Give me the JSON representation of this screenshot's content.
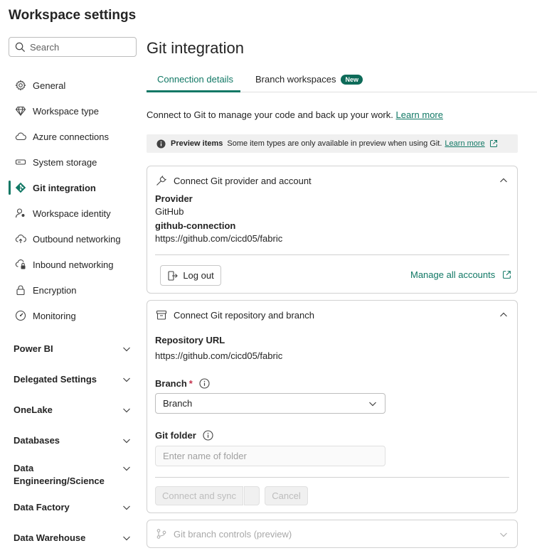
{
  "page": {
    "title": "Workspace settings"
  },
  "search": {
    "placeholder": "Search"
  },
  "sidebar": {
    "items": [
      {
        "label": "General"
      },
      {
        "label": "Workspace type"
      },
      {
        "label": "Azure connections"
      },
      {
        "label": "System storage"
      },
      {
        "label": "Git integration"
      },
      {
        "label": "Workspace identity"
      },
      {
        "label": "Outbound networking"
      },
      {
        "label": "Inbound networking"
      },
      {
        "label": "Encryption"
      },
      {
        "label": "Monitoring"
      }
    ],
    "groups": [
      {
        "label": "Power BI"
      },
      {
        "label": "Delegated Settings"
      },
      {
        "label": "OneLake"
      },
      {
        "label": "Databases"
      },
      {
        "label": "Data Engineering/Science"
      },
      {
        "label": "Data Factory"
      },
      {
        "label": "Data Warehouse"
      }
    ]
  },
  "main": {
    "title": "Git integration",
    "tabs": [
      {
        "label": "Connection details"
      },
      {
        "label": "Branch workspaces",
        "badge": "New"
      }
    ],
    "intro": "Connect to Git to manage your code and back up your work.",
    "intro_link": "Learn more",
    "preview": {
      "title": "Preview items",
      "text": "Some item types are only available in preview when using Git.",
      "link": "Learn more"
    },
    "provider_card": {
      "title": "Connect Git provider and account",
      "provider_label": "Provider",
      "provider_value": "GitHub",
      "connection_label": "github-connection",
      "connection_value": "https://github.com/cicd05/fabric",
      "logout_label": "Log out",
      "manage_label": "Manage all accounts"
    },
    "repo_card": {
      "title": "Connect Git repository and branch",
      "repo_label": "Repository URL",
      "repo_value": "https://github.com/cicd05/fabric",
      "branch_label": "Branch",
      "required_mark": "*",
      "branch_value": "Branch",
      "folder_label": "Git folder",
      "folder_placeholder": "Enter name of folder",
      "connect_label": "Connect and sync",
      "cancel_label": "Cancel"
    },
    "branch_controls": {
      "title": "Git branch controls (preview)"
    }
  }
}
